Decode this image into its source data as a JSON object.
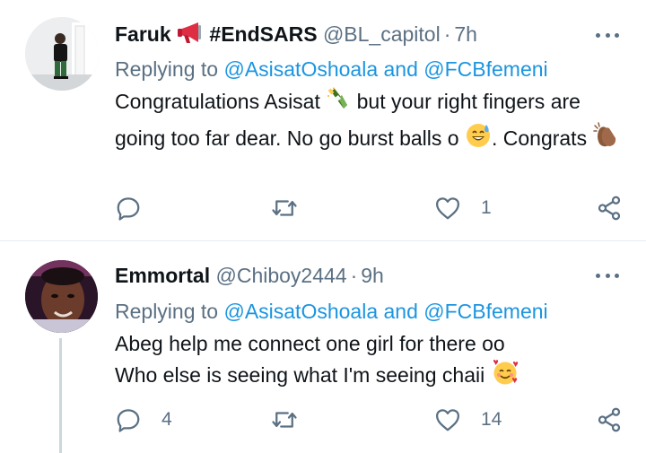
{
  "tweets": [
    {
      "name": "Faruk",
      "hashtag": "#EndSARS",
      "handle": "@BL_capitol",
      "time": "7h",
      "replying_prefix": "Replying to",
      "mention_1": "@AsisatOshoala",
      "and_word": "and",
      "mention_2": "@FCBfemeni",
      "text_1": "Congratulations Asisat",
      "text_2": "but your right fingers are going too far dear. No go burst balls o",
      "text_3": ". Congrats",
      "reply_count": "",
      "retweet_count": "",
      "like_count": "1",
      "icons": [
        "megaphone-emoji",
        "champagne-emoji",
        "sweat-smile-emoji",
        "clapping-hands-emoji"
      ]
    },
    {
      "name": "Emmortal",
      "handle": "@Chiboy2444",
      "time": "9h",
      "replying_prefix": "Replying to",
      "mention_1": "@AsisatOshoala",
      "and_word": "and",
      "mention_2": "@FCBfemeni",
      "line_1": "Abeg help me connect one girl for there oo",
      "line_2": "Who else is seeing what I'm seeing chaii",
      "reply_count": "4",
      "retweet_count": "",
      "like_count": "14",
      "icons": [
        "smiling-face-with-hearts-emoji"
      ]
    }
  ],
  "colors": {
    "text": "#0f1419",
    "secondary": "#5b7083",
    "link": "#1b95e0",
    "divider": "#e6ecf0",
    "thread_line": "#ccd6dd"
  }
}
